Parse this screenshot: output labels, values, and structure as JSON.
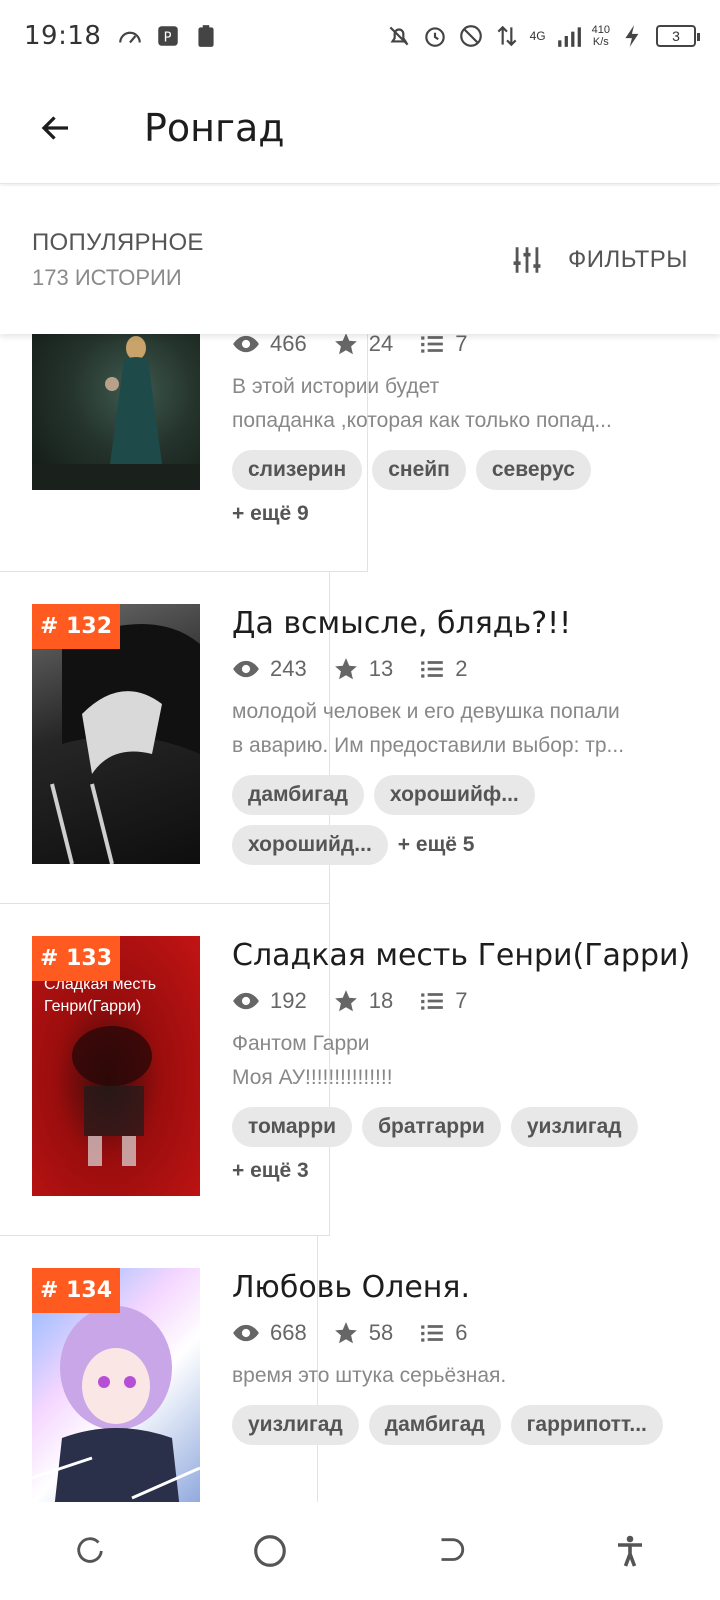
{
  "status": {
    "time": "19:18",
    "net_speed_value": "410",
    "net_speed_unit": "K/s",
    "network": "4G",
    "battery": "3"
  },
  "appbar": {
    "title": "Ронгад"
  },
  "sort": {
    "title": "ПОПУЛЯРНОЕ",
    "count": "173 ИСТОРИИ",
    "filters_label": "ФИЛЬТРЫ"
  },
  "stories": [
    {
      "rank": "",
      "title": "",
      "views": "466",
      "stars": "24",
      "chapters": "7",
      "desc1": "В этой истории будет",
      "desc2": "попаданка ,которая как только попад...",
      "tags": [
        "слизерин",
        "снейп",
        "северус"
      ],
      "more": "+ ещё 9"
    },
    {
      "rank": "# 132",
      "title": "Да всмысле, блядь?!!",
      "views": "243",
      "stars": "13",
      "chapters": "2",
      "desc1": "молодой человек и его девушка попали",
      "desc2": "в аварию. Им предоставили выбор: тр...",
      "tags": [
        "дамбигад",
        "хорошийф...",
        "хорошийд..."
      ],
      "more": "+ ещё 5"
    },
    {
      "rank": "# 133",
      "title": "Сладкая месть Генри(Гарри)",
      "cover_caption": "Сладкая месть Генри(Гарри)",
      "views": "192",
      "stars": "18",
      "chapters": "7",
      "desc1": "Фантом Гарри",
      "desc2": "Моя АУ!!!!!!!!!!!!!!!",
      "tags": [
        "томарри",
        "братгарри",
        "уизлигад"
      ],
      "more": "+ ещё 3"
    },
    {
      "rank": "# 134",
      "title": "Любовь Оленя.",
      "views": "668",
      "stars": "58",
      "chapters": "6",
      "desc1": "время это штука серьёзная.",
      "tags": [
        "уизлигад",
        "дамбигад",
        "гаррипотт..."
      ]
    }
  ],
  "colors": {
    "rank_badge": "#ff5a1f",
    "tag_bg": "#e8e8e8"
  }
}
